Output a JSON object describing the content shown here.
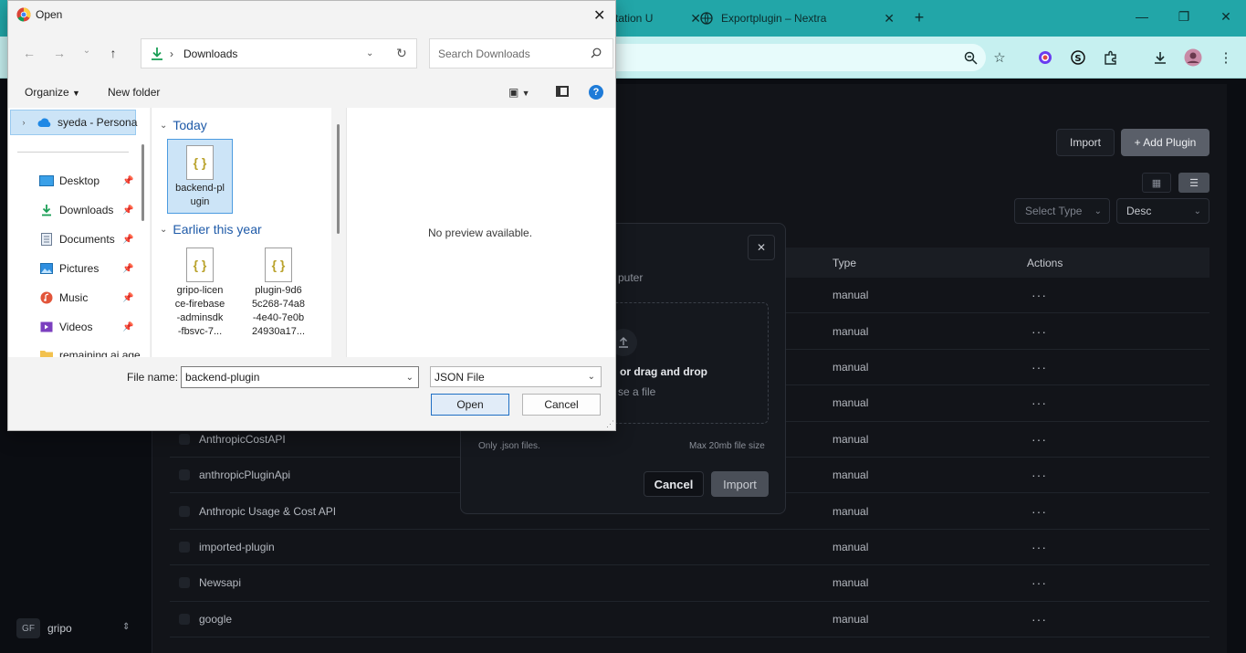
{
  "browser": {
    "tabs": [
      {
        "label": "tation U",
        "active": false
      },
      {
        "label": "Exportplugin – Nextra",
        "active": false
      }
    ],
    "new_tab_icon": "plus-icon",
    "window_controls": [
      "minimize-icon",
      "restore-icon",
      "close-icon"
    ],
    "toolbar_icons": [
      "zoom-icon",
      "star-icon",
      "color-extension-icon",
      "s-extension-icon",
      "puzzle-icon",
      "download-icon",
      "profile-avatar",
      "kebab-menu-icon"
    ]
  },
  "app": {
    "import_label": "Import",
    "add_plugin_label": "+ Add Plugin",
    "select_type_placeholder": "Select Type",
    "sort_value": "Desc",
    "table": {
      "headers": {
        "type": "Type",
        "actions": "Actions"
      },
      "rows": [
        {
          "name": "",
          "type": "manual"
        },
        {
          "name": "",
          "type": "manual"
        },
        {
          "name": "",
          "type": "manual"
        },
        {
          "name": "",
          "type": "manual"
        },
        {
          "name": "AnthropicCostAPI",
          "type": "manual"
        },
        {
          "name": "anthropicPluginApi",
          "type": "manual"
        },
        {
          "name": "Anthropic Usage & Cost API",
          "type": "manual"
        },
        {
          "name": "imported-plugin",
          "type": "manual"
        },
        {
          "name": "Newsapi",
          "type": "manual"
        },
        {
          "name": "google",
          "type": "manual"
        }
      ],
      "more_label": "···"
    },
    "user": {
      "initials": "GF",
      "name": "gripo"
    }
  },
  "import_modal": {
    "subtitle_fragment": "puter",
    "drop_main": "or drag and drop",
    "drop_sub": "se a file",
    "only_json": "Only .json files.",
    "max_size": "Max 20mb file size",
    "cancel_label": "Cancel",
    "import_label": "Import"
  },
  "open_dialog": {
    "title": "Open",
    "address_path": "Downloads",
    "search_placeholder": "Search Downloads",
    "organize_label": "Organize",
    "new_folder_label": "New folder",
    "help_label": "?",
    "nav_items": [
      {
        "label": "syeda - Persona",
        "icon": "onedrive-cloud-icon"
      },
      {
        "label": "Desktop",
        "icon": "desktop-icon",
        "pinned": true
      },
      {
        "label": "Downloads",
        "icon": "download-arrow-icon",
        "pinned": true
      },
      {
        "label": "Documents",
        "icon": "documents-icon",
        "pinned": true
      },
      {
        "label": "Pictures",
        "icon": "pictures-icon",
        "pinned": true
      },
      {
        "label": "Music",
        "icon": "music-icon",
        "pinned": true
      },
      {
        "label": "Videos",
        "icon": "videos-icon",
        "pinned": true
      },
      {
        "label": "remaining ai age",
        "icon": "folder-icon"
      }
    ],
    "groups": [
      {
        "label": "Today",
        "files": [
          {
            "name": "backend-pl\nugin",
            "selected": true
          }
        ]
      },
      {
        "label": "Earlier this year",
        "files": [
          {
            "name": "gripo-licen\nce-firebase\n-adminsdk\n-fbsvc-7...",
            "selected": false
          },
          {
            "name": "plugin-9d6\n5c268-74a8\n-4e40-7e0b\n24930a17...",
            "selected": false
          }
        ]
      }
    ],
    "file_icon_glyph": "{ }",
    "preview_text": "No preview available.",
    "file_name_label": "File name:",
    "file_name_value": "backend-plugin",
    "file_type_value": "JSON File",
    "open_label": "Open",
    "cancel_label": "Cancel"
  }
}
